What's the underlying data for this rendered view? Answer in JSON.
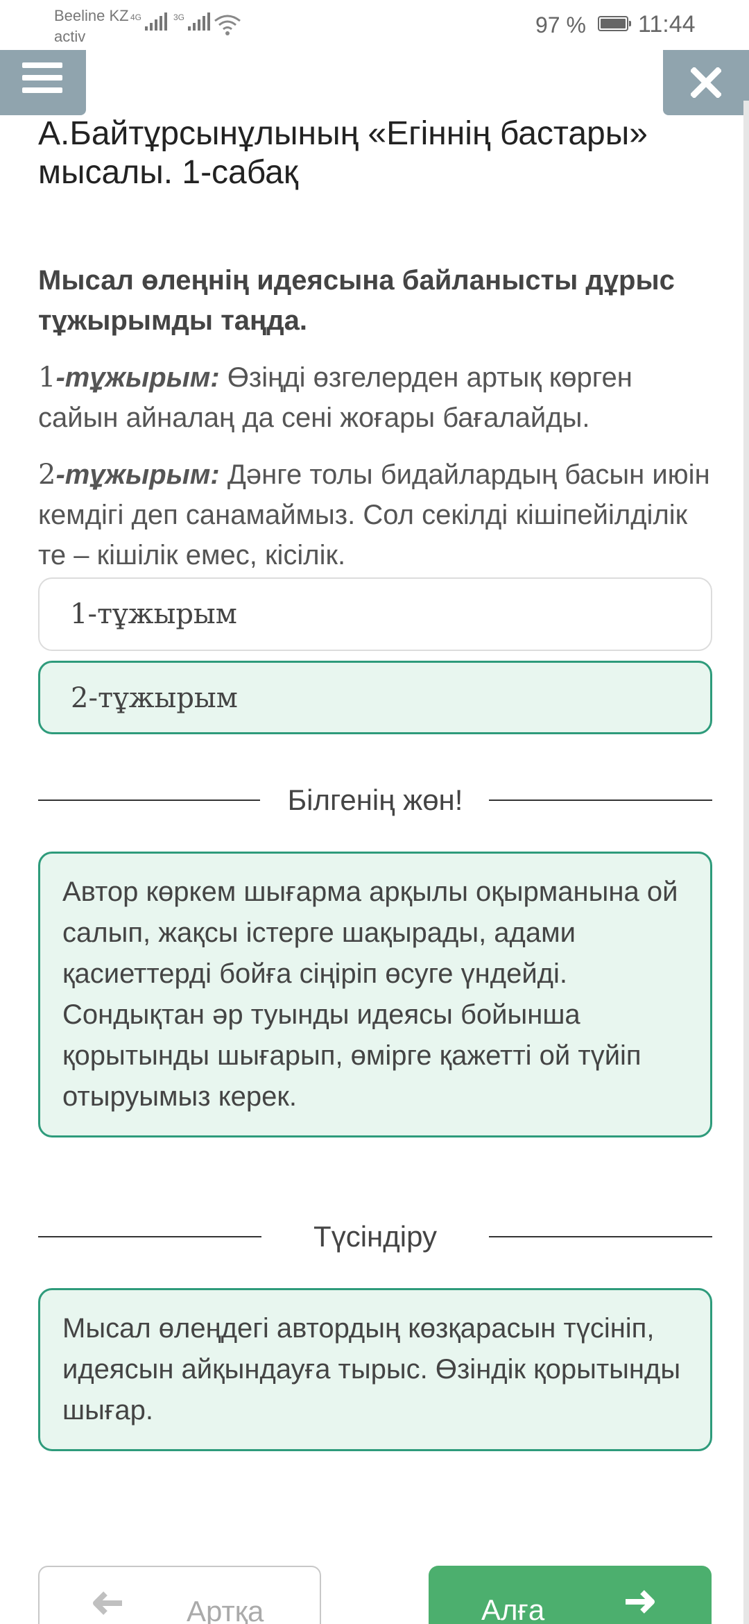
{
  "status_bar": {
    "carrier_line1": "Beeline KZ",
    "carrier_line2": "activ",
    "signal1_label": "4G",
    "signal2_label": "3G",
    "battery": "97 %",
    "time": "11:44"
  },
  "header": {
    "menu_icon": "hamburger-icon",
    "close_icon": "close-icon"
  },
  "lesson": {
    "title": "А.Байтұрсынұлының «Егіннің бастары» мысалы. 1-сабақ"
  },
  "question": {
    "prompt": "Мысал өлеңнің идеясына байланысты дұрыс тұжырымды таңда.",
    "statements": [
      {
        "num": "1",
        "label": "-тұжырым:",
        "text": " Өзіңді өзгелерден артық көрген сайын айналаң да сені жоғары бағалайды."
      },
      {
        "num": "2",
        "label": "-тұжырым:",
        "text": " Дәнге толы бидайлардың басын июін кемдігі деп санамаймыз. Сол секілді кішіпейілділік те – кішілік емес, кісілік."
      }
    ]
  },
  "options": [
    {
      "label": "1-тұжырым",
      "state": "default"
    },
    {
      "label": "2-тұжырым",
      "state": "correct"
    }
  ],
  "know_section": {
    "heading": "Білгенің жөн!",
    "text": "Автор көркем шығарма арқылы оқырманына ой салып, жақсы істерге шақырады, адами қасиеттерді бойға сіңіріп өсуге үндейді. Сондықтан әр туынды идеясы бойынша қорытынды шығарып, өмірге қажетті ой түйіп отыруымыз керек."
  },
  "explain_section": {
    "heading": "Түсіндіру",
    "text": "Мысал өлеңдегі автордың көзқарасын түсініп, идеясын айқындауға тырыс. Өзіндік қорытынды шығар."
  },
  "navigation": {
    "back_label": "Артқа",
    "next_label": "Алға",
    "back_icon": "arrow-left-icon",
    "next_icon": "arrow-right-icon"
  },
  "colors": {
    "accent_green": "#2e9b7b",
    "correct_bg": "#e8f6ef",
    "next_button": "#4caf6e",
    "header_buttons": "#90a4ae"
  }
}
